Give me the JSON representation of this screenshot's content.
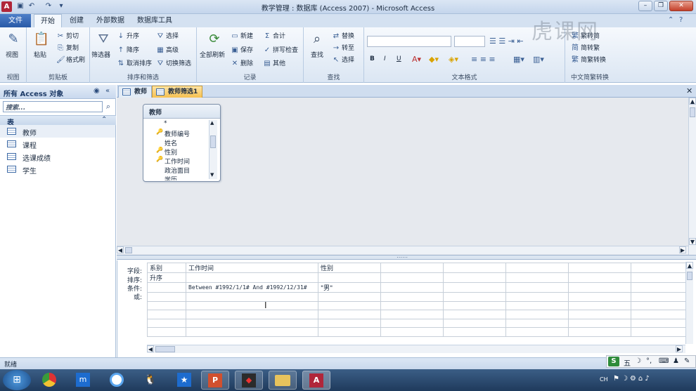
{
  "window": {
    "title": "教学管理 : 数据库 (Access 2007) - Microsoft Access",
    "app_icon": "A",
    "controls": {
      "minimize": "–",
      "restore": "❐",
      "close": "✕"
    }
  },
  "ribbon_tabs": [
    "文件",
    "开始",
    "创建",
    "外部数据",
    "数据库工具"
  ],
  "ribbon": {
    "view": {
      "label": "视图",
      "group": "视图"
    },
    "clipboard": {
      "paste": "粘贴",
      "cut": "剪切",
      "copy": "复制",
      "format_painter": "格式刷",
      "group": "剪贴板"
    },
    "sort_filter": {
      "filter": "筛选器",
      "ascending": "升序",
      "descending": "降序",
      "remove_sort": "取消排序",
      "selection": "选择",
      "advanced": "高级",
      "toggle_filter": "切换筛选",
      "group": "排序和筛选"
    },
    "records": {
      "refresh_all": "全部刷新",
      "new": "新建",
      "save": "保存",
      "delete": "删除",
      "totals": "合计",
      "spelling": "拼写检查",
      "more": "其他",
      "group": "记录"
    },
    "find": {
      "find": "查找",
      "replace": "替换",
      "goto": "转至",
      "select": "选择",
      "group": "查找"
    },
    "text_format": {
      "bold": "B",
      "italic": "I",
      "underline": "U",
      "group": "文本格式"
    },
    "chinese_conversion": {
      "trad_to_simp": "繁转简",
      "simp_to_trad": "简转繁",
      "convert": "简繁转换",
      "group": "中文简繁转换"
    }
  },
  "nav": {
    "title": "所有 Access 对象",
    "search_placeholder": "搜索...",
    "section": "表",
    "items": [
      "教师",
      "课程",
      "选课成绩",
      "学生"
    ]
  },
  "doc_tabs": [
    "教师",
    "教师筛选1"
  ],
  "field_list": {
    "title": "教师",
    "fields": [
      "*",
      "教师编号",
      "姓名",
      "性别",
      "工作时间",
      "政治面目",
      "学历"
    ]
  },
  "grid": {
    "row_labels": [
      "字段:",
      "排序:",
      "条件:",
      "或:"
    ],
    "columns": [
      {
        "field": "系别",
        "sort": "升序",
        "criteria": "",
        "or": ""
      },
      {
        "field": "工作时间",
        "sort": "",
        "criteria": "Between #1992/1/1# And #1992/12/31#",
        "or": ""
      },
      {
        "field": "性别",
        "sort": "",
        "criteria": "\"男\"",
        "or": ""
      }
    ]
  },
  "status": "就绪",
  "tray": {
    "lang": "CH",
    "ime": "五"
  },
  "watermark": "虎课网"
}
